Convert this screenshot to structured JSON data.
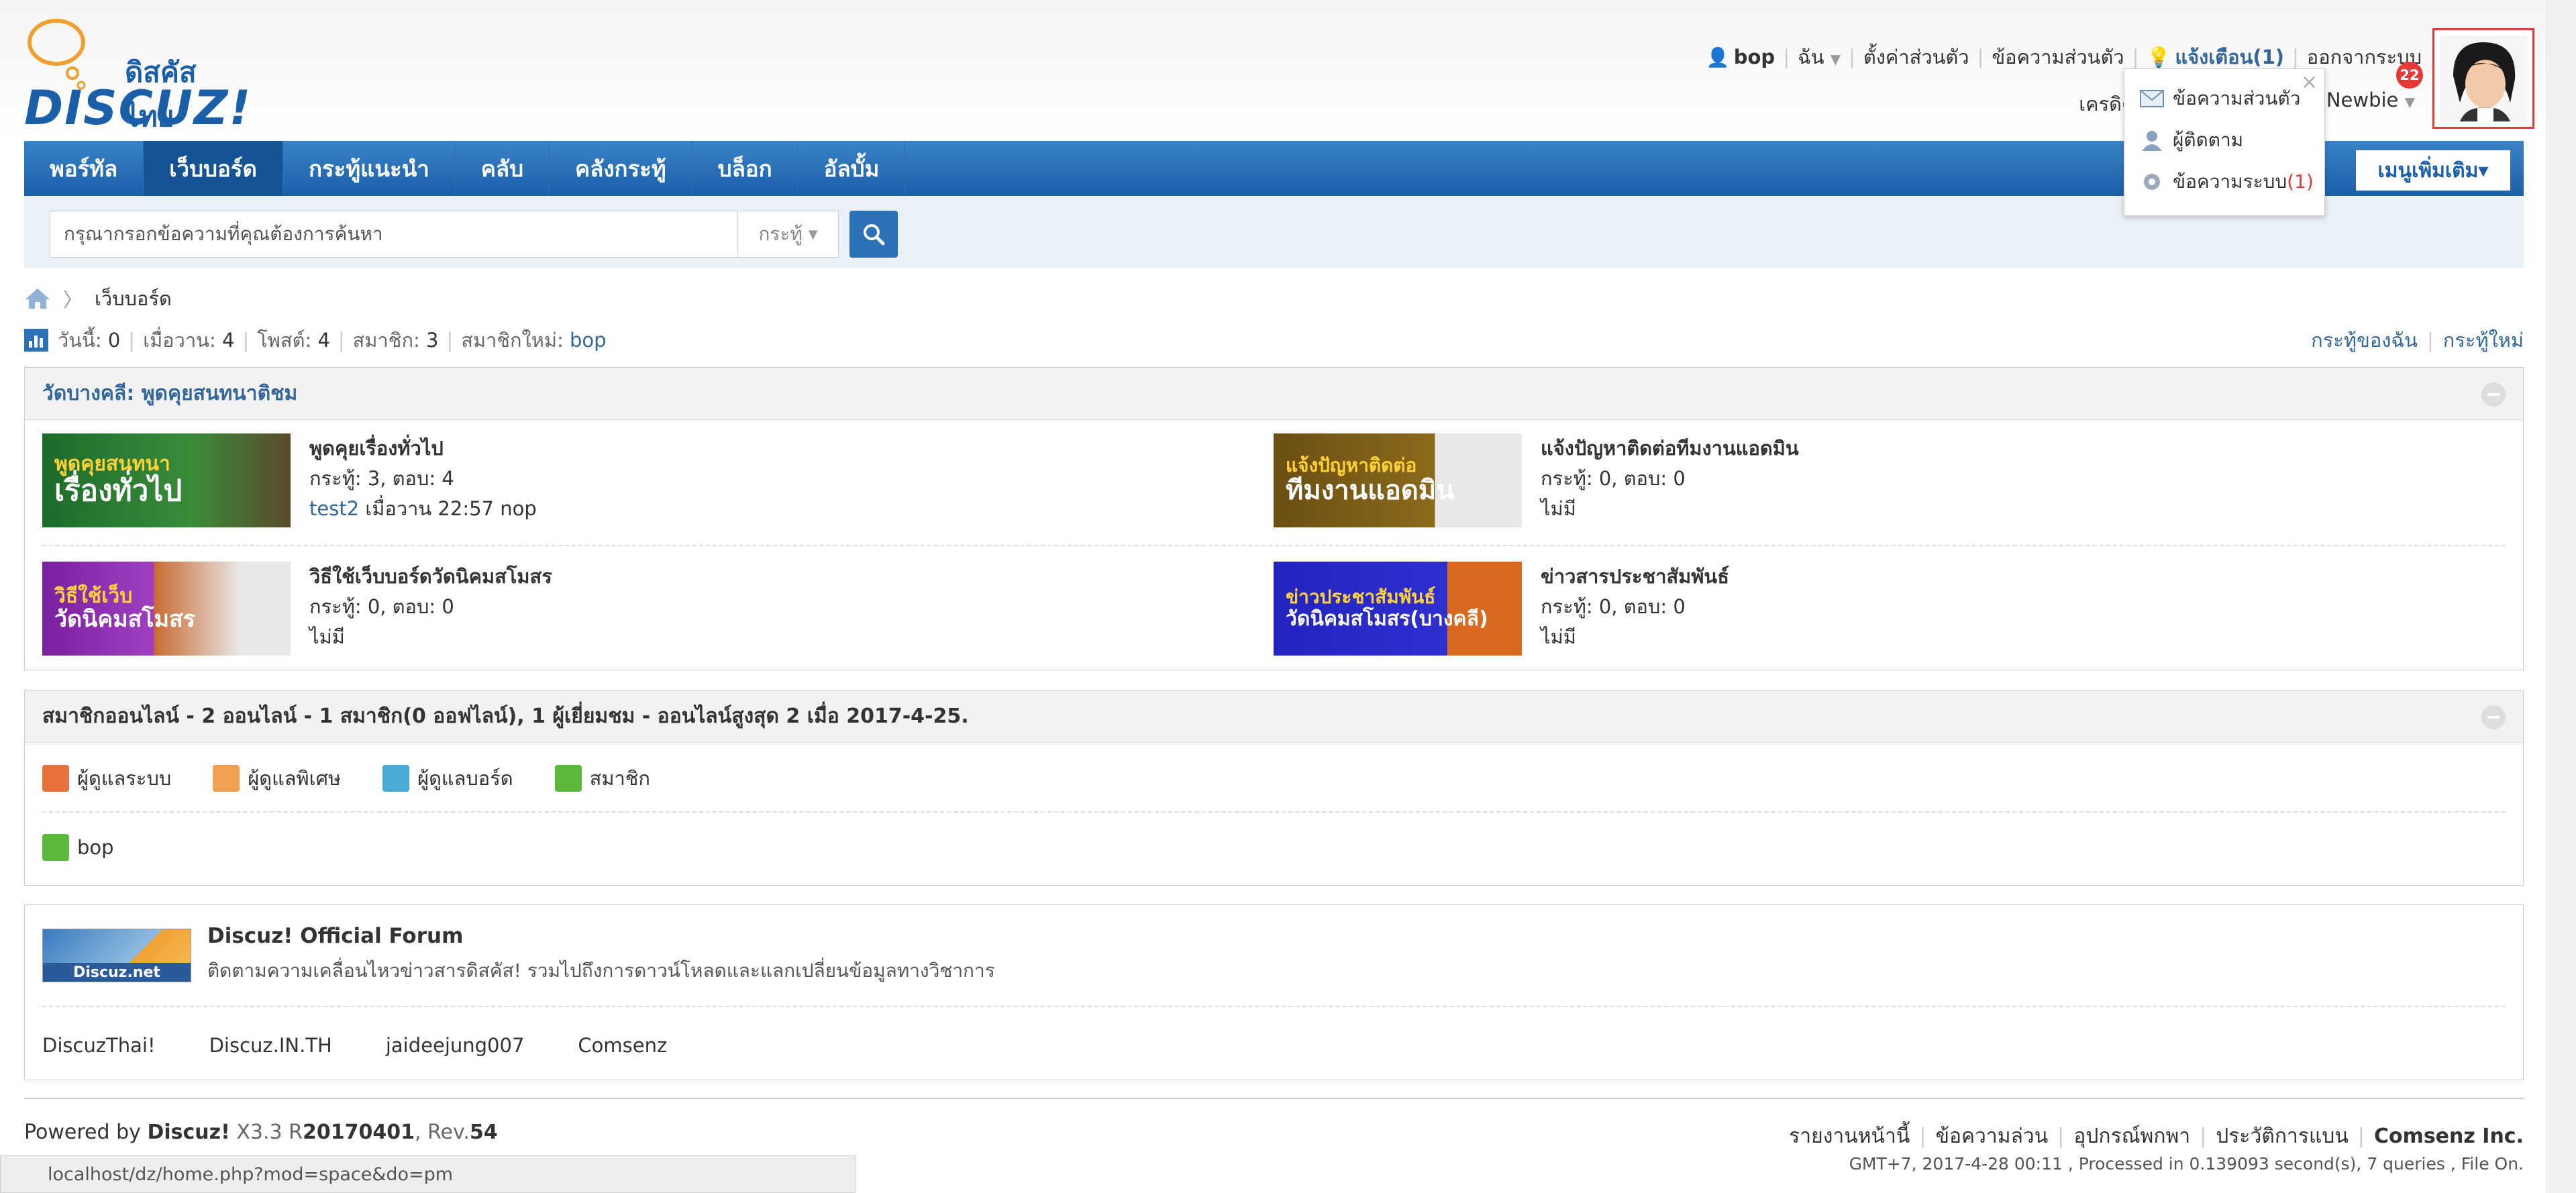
{
  "header": {
    "logo_thai": "ดิสคัสไทย",
    "logo_text": "DISCUZ!",
    "user": {
      "username": "bop",
      "me": "ฉัน",
      "settings": "ตั้งค่าส่วนตัว",
      "messages": "ข้อความส่วนตัว",
      "notifications": "แจ้งเตือน(1)",
      "logout": "ออกจากระบบ",
      "credit_label": "เครดิต",
      "group": "Newbie"
    },
    "avatar_badge": "22"
  },
  "dropdown": {
    "items": [
      {
        "label": "ข้อความส่วนตัว",
        "icon": "envelope-icon"
      },
      {
        "label": "ผู้ติดตาม",
        "icon": "user-icon"
      },
      {
        "label": "ข้อความระบบ",
        "count": "(1)",
        "icon": "gear-icon"
      }
    ],
    "close": "×"
  },
  "nav": {
    "items": [
      "พอร์ทัล",
      "เว็บบอร์ด",
      "กระทู้แนะนำ",
      "คลับ",
      "คลังกระทู้",
      "บล็อก",
      "อัลบั้ม"
    ],
    "active_index": 1,
    "more": "เมนูเพิ่มเติม▾"
  },
  "search": {
    "placeholder": "กรุณากรอกข้อความที่คุณต้องการค้นหา",
    "type": "กระทู้"
  },
  "breadcrumb": {
    "current": "เว็บบอร์ด"
  },
  "stats": {
    "today_label": "วันนี้:",
    "today": "0",
    "yesterday_label": "เมื่อวาน:",
    "yesterday": "4",
    "posts_label": "โพสต์:",
    "posts": "4",
    "members_label": "สมาชิก:",
    "members": "3",
    "newest_label": "สมาชิกใหม่:",
    "newest": "bop",
    "my_threads": "กระทู้ของฉัน",
    "new_threads": "กระทู้ใหม่"
  },
  "category": {
    "title": "วัดบางคลี: พูดคุยสนทนาติชม",
    "forums": [
      {
        "name": "พูดคุยเรื่องทั่วไป",
        "counts": "กระทู้: 3, ตอบ: 4",
        "last_user": "test2",
        "last_time": "เมื่อวาน 22:57 nop",
        "img_top": "พูดคุยสนทนา",
        "img_bottom": "เรื่องทั่วไป",
        "color": "#1d6b2a"
      },
      {
        "name": "แจ้งปัญหาติดต่อทีมงานแอดมิน",
        "counts": "กระทู้: 0, ตอบ: 0",
        "last_user": "",
        "last_time": "ไม่มี",
        "img_top": "แจ้งปัญหาติดต่อ",
        "img_bottom": "ทีมงานแอดมิน",
        "color": "#6b4e12"
      },
      {
        "name": "วิธีใช้เว็บบอร์ดวัดนิคมสโมสร",
        "counts": "กระทู้: 0, ตอบ: 0",
        "last_user": "",
        "last_time": "ไม่มี",
        "img_top": "วิธีใช้เว็บ",
        "img_bottom": "วัดนิคมสโมสร",
        "color": "#7a1fa0"
      },
      {
        "name": "ข่าวสารประชาสัมพันธ์",
        "counts": "กระทู้: 0, ตอบ: 0",
        "last_user": "",
        "last_time": "ไม่มี",
        "img_top": "ข่าวประชาสัมพันธ์",
        "img_bottom": "วัดนิคมสโมสร(บางคลี)",
        "color": "#2323c0"
      }
    ]
  },
  "online": {
    "title": "สมาชิกออนไลน์ - 2 ออนไลน์ - 1 สมาชิก(0 ออฟไลน์), 1 ผู้เยี่ยมชม - ออนไลน์สูงสุด 2 เมื่อ 2017-4-25.",
    "legend": [
      {
        "label": "ผู้ดูแลระบบ",
        "color": "#e8703a"
      },
      {
        "label": "ผู้ดูแลพิเศษ",
        "color": "#f0a050"
      },
      {
        "label": "ผู้ดูแลบอร์ด",
        "color": "#4aaad8"
      },
      {
        "label": "สมาชิก",
        "color": "#5cb83c"
      }
    ],
    "users": [
      "bop"
    ]
  },
  "links": {
    "featured_name": "Discuz! Official Forum",
    "featured_desc": "ติดตามความเคลื่อนไหวข่าวสารดิสคัส! รวมไปถึงการดาวน์โหลดและแลกเปลี่ยนข้อมูลทางวิชาการ",
    "featured_logo": "Discuz.net",
    "text_links": [
      "DiscuzThai!",
      "Discuz.IN.TH",
      "jaideejung007",
      "Comsenz"
    ]
  },
  "footer": {
    "powered": "Powered by",
    "brand": "Discuz!",
    "version": "X3.3 R",
    "release": "20170401",
    "rev_label": ", Rev.",
    "rev": "54",
    "links": [
      "รายงานหน้านี้",
      "ข้อความล่วน",
      "อุปกรณ์พกพา",
      "ประวัติการแบน"
    ],
    "company": "Comsenz Inc.",
    "meta": "GMT+7, 2017-4-28 00:11 , Processed in 0.139093 second(s), 7 queries , File On.",
    "status_url": "localhost/dz/home.php?mod=space&do=pm"
  }
}
